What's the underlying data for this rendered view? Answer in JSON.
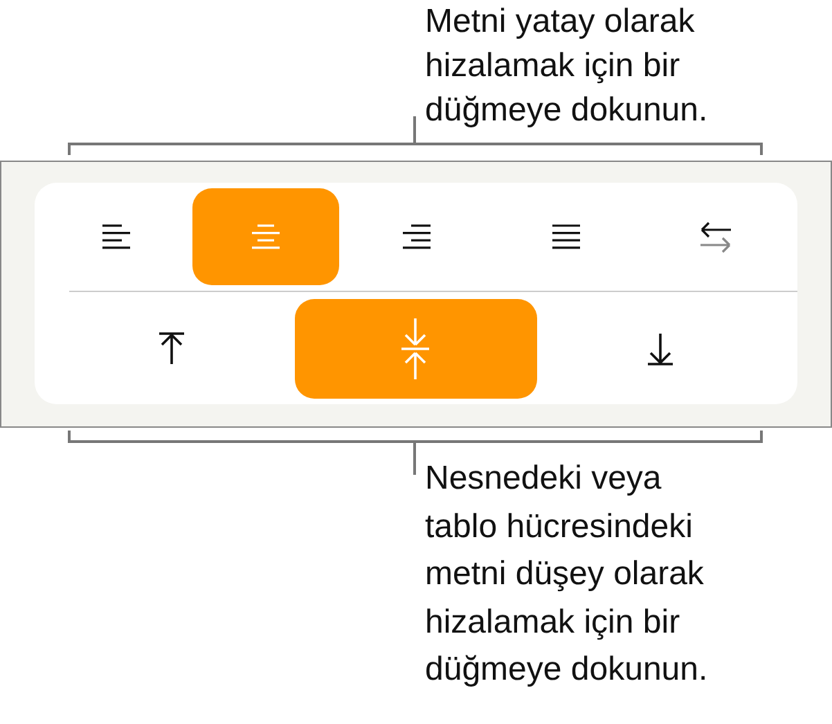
{
  "top_callout": "Metni yatay olarak\nhizalamak için bir\ndüğmeye dokunun.",
  "horizontal_buttons": [
    {
      "kind": "left",
      "selected": false
    },
    {
      "kind": "center",
      "selected": true
    },
    {
      "kind": "right",
      "selected": false
    },
    {
      "kind": "justify",
      "selected": false
    },
    {
      "kind": "direction",
      "selected": false
    }
  ],
  "vertical_buttons": [
    {
      "kind": "top",
      "selected": false
    },
    {
      "kind": "middle",
      "selected": true
    },
    {
      "kind": "bottom",
      "selected": false
    }
  ],
  "bottom_callout": "Nesnedeki veya\ntablo hücresindeki\nmetni düşey olarak\nhizalamak için bir\ndüğmeye dokunun."
}
